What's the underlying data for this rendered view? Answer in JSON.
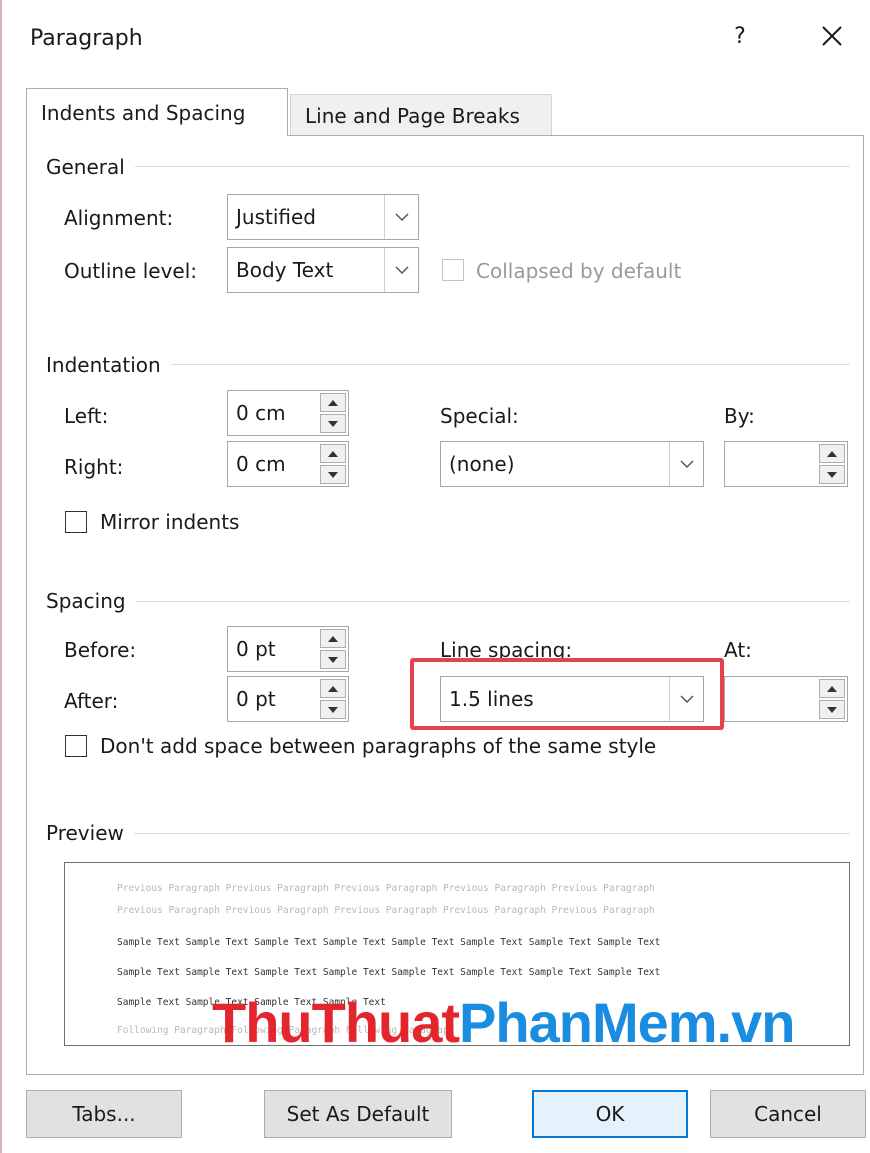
{
  "window": {
    "title": "Paragraph",
    "help_label": "?"
  },
  "tabs": [
    {
      "label": "Indents and Spacing",
      "active": true
    },
    {
      "label": "Line and Page Breaks",
      "active": false
    }
  ],
  "general": {
    "heading": "General",
    "alignment_label": "Alignment:",
    "alignment_value": "Justified",
    "outline_label": "Outline level:",
    "outline_value": "Body Text",
    "collapsed_label": "Collapsed by default"
  },
  "indentation": {
    "heading": "Indentation",
    "left_label": "Left:",
    "left_value": "0 cm",
    "right_label": "Right:",
    "right_value": "0 cm",
    "special_label": "Special:",
    "special_value": "(none)",
    "by_label": "By:",
    "by_value": "",
    "mirror_label": "Mirror indents"
  },
  "spacing": {
    "heading": "Spacing",
    "before_label": "Before:",
    "before_value": "0 pt",
    "after_label": "After:",
    "after_value": "0 pt",
    "line_spacing_label": "Line spacing:",
    "line_spacing_value": "1.5 lines",
    "at_label": "At:",
    "at_value": "",
    "dont_add_label": "Don't add space between paragraphs of the same style"
  },
  "preview": {
    "heading": "Preview",
    "previous_lines": [
      "Previous Paragraph Previous Paragraph Previous Paragraph Previous Paragraph Previous Paragraph",
      "Previous Paragraph Previous Paragraph Previous Paragraph Previous Paragraph Previous Paragraph"
    ],
    "sample_lines": [
      "Sample Text Sample Text Sample Text Sample Text Sample Text Sample Text Sample Text Sample Text",
      "Sample Text Sample Text Sample Text Sample Text Sample Text Sample Text Sample Text Sample Text",
      "Sample Text Sample Text Sample Text Sample Text"
    ],
    "following_line": "Following Paragraph Following Paragraph Following Paragraph"
  },
  "watermark": {
    "part1": "ThuThuat",
    "part2": "PhanMem",
    "part3": ".vn"
  },
  "buttons": {
    "tabs": "Tabs...",
    "set_default": "Set As Default",
    "ok": "OK",
    "cancel": "Cancel"
  },
  "colors": {
    "highlight": "#e5434a",
    "ok_border": "#0078d7",
    "watermark_red": "#e3262d",
    "watermark_blue": "#1a8de0"
  }
}
